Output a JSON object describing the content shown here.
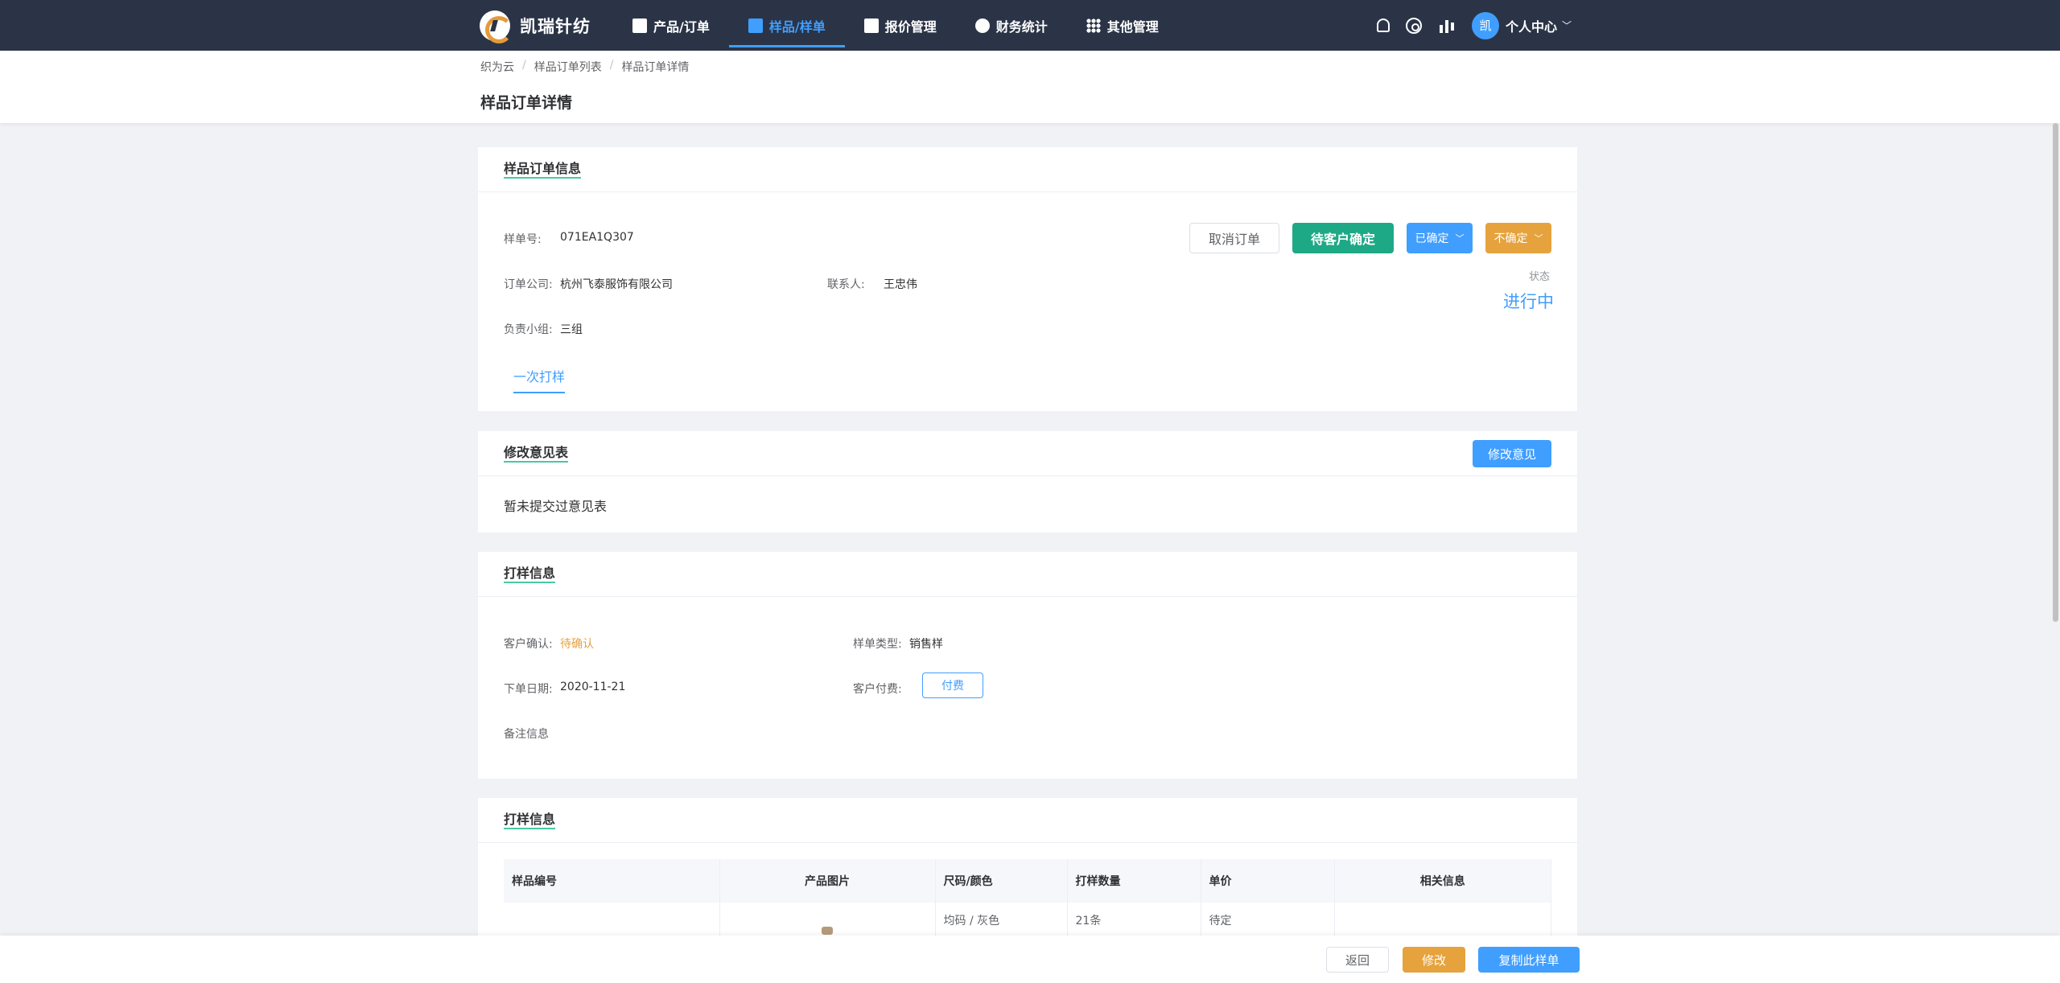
{
  "brand": {
    "name": "凯瑞针纺"
  },
  "nav": {
    "items": [
      {
        "label": "产品/订单"
      },
      {
        "label": "样品/样单"
      },
      {
        "label": "报价管理"
      },
      {
        "label": "财务统计"
      },
      {
        "label": "其他管理"
      }
    ],
    "avatar_text": "凯",
    "user_label": "个人中心"
  },
  "breadcrumb": [
    "织为云",
    "样品订单列表",
    "样品订单详情"
  ],
  "page_title": "样品订单详情",
  "order_info": {
    "title": "样品订单信息",
    "sample_no_label": "样单号:",
    "sample_no": "071EA1Q307",
    "company_label": "订单公司:",
    "company": "杭州飞泰服饰有限公司",
    "contact_label": "联系人:",
    "contact": "王忠伟",
    "group_label": "负责小组:",
    "group": "三组",
    "buttons": {
      "cancel": "取消订单",
      "pending_confirm": "待客户确定",
      "confirmed": "已确定",
      "unconfirmed": "不确定"
    },
    "status_label": "状态",
    "status_value": "进行中",
    "tab": "一次打样"
  },
  "feedback": {
    "title": "修改意见表",
    "button": "修改意见",
    "empty_text": "暂未提交过意见表"
  },
  "sampling_info": {
    "title": "打样信息",
    "customer_confirm_label": "客户确认:",
    "customer_confirm": "待确认",
    "sample_type_label": "样单类型:",
    "sample_type": "销售样",
    "order_date_label": "下单日期:",
    "order_date": "2020-11-21",
    "customer_pay_label": "客户付费:",
    "pay_button": "付费",
    "remark_label": "备注信息"
  },
  "sampling_table": {
    "title": "打样信息",
    "columns": [
      "样品编号",
      "产品图片",
      "尺码/颜色",
      "打样数量",
      "单价",
      "相关信息"
    ],
    "rows": [
      {
        "size_color": "均码 / 灰色",
        "quantity": "21条",
        "price": "待定"
      }
    ]
  },
  "bottom": {
    "back": "返回",
    "edit": "修改",
    "copy": "复制此样单"
  },
  "colors": {
    "nav_bg": "#2b3447",
    "accent_blue": "#409eff",
    "accent_green": "#1ea986",
    "accent_orange": "#e6a23c"
  }
}
